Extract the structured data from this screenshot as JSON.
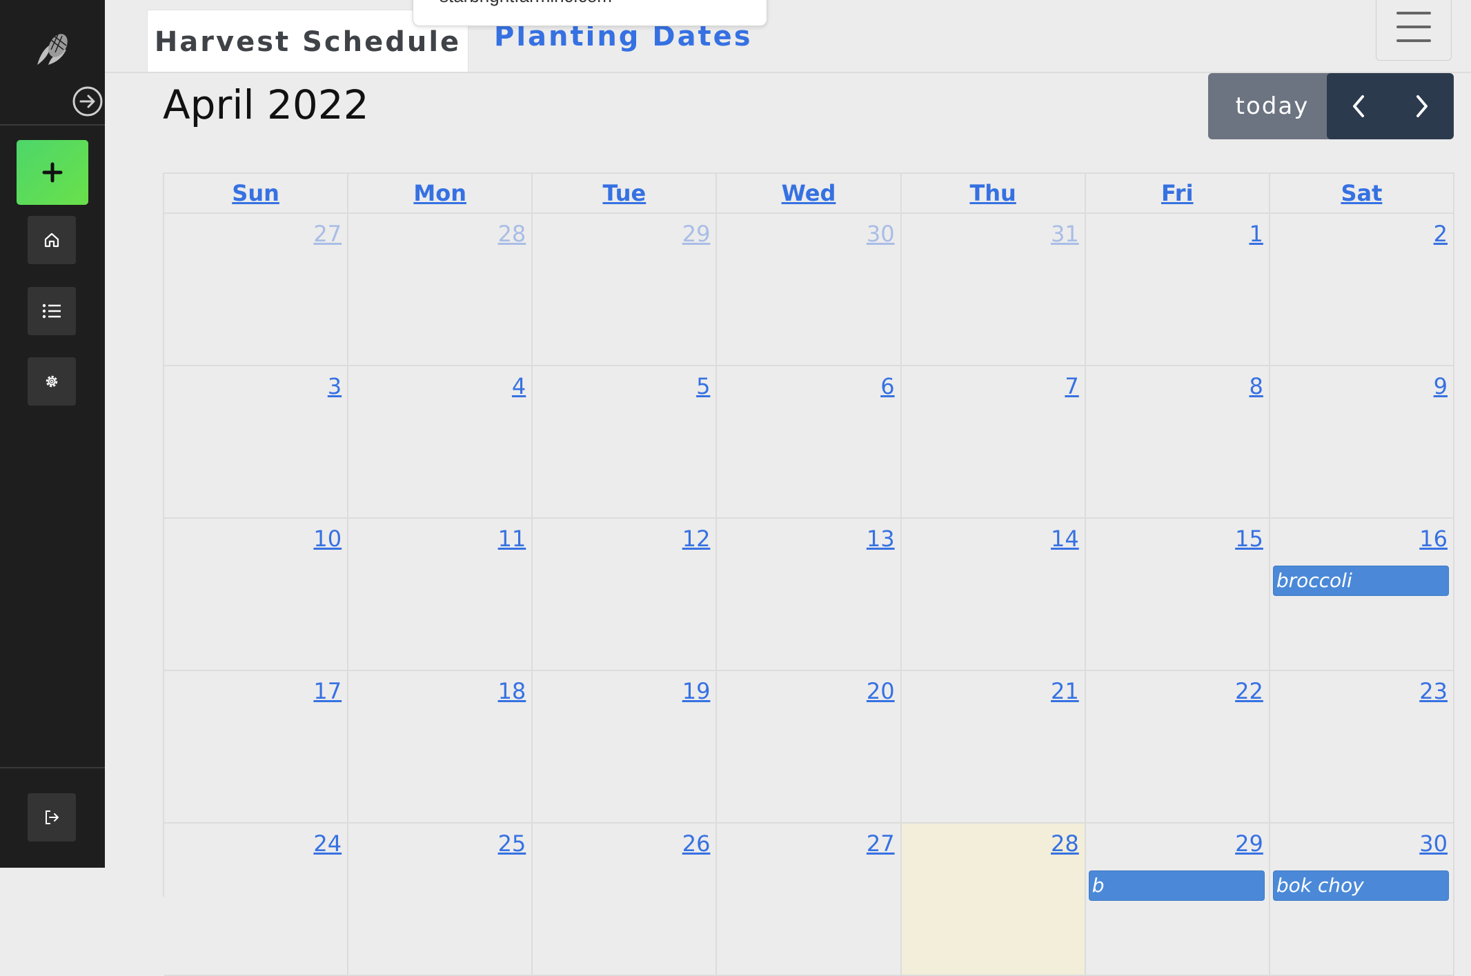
{
  "sidebar": {
    "icons": [
      "corn-logo-icon",
      "arrow-right-circle-icon",
      "plus-icon",
      "home-icon",
      "list-icon",
      "gear-icon",
      "logout-icon"
    ]
  },
  "tabs": [
    {
      "label": "Harvest Schedule",
      "active": true
    },
    {
      "label": "Planting Dates",
      "active": false
    }
  ],
  "url_popup": {
    "text": "starbrightfarminc.com"
  },
  "calendar": {
    "title": "April 2022",
    "today_label": "today",
    "weekdays": [
      "Sun",
      "Mon",
      "Tue",
      "Wed",
      "Thu",
      "Fri",
      "Sat"
    ],
    "weeks": [
      [
        {
          "d": "27",
          "other": true
        },
        {
          "d": "28",
          "other": true
        },
        {
          "d": "29",
          "other": true
        },
        {
          "d": "30",
          "other": true
        },
        {
          "d": "31",
          "other": true
        },
        {
          "d": "1"
        },
        {
          "d": "2"
        }
      ],
      [
        {
          "d": "3"
        },
        {
          "d": "4"
        },
        {
          "d": "5"
        },
        {
          "d": "6"
        },
        {
          "d": "7"
        },
        {
          "d": "8"
        },
        {
          "d": "9"
        }
      ],
      [
        {
          "d": "10"
        },
        {
          "d": "11"
        },
        {
          "d": "12"
        },
        {
          "d": "13"
        },
        {
          "d": "14"
        },
        {
          "d": "15"
        },
        {
          "d": "16",
          "event": "broccoli"
        }
      ],
      [
        {
          "d": "17"
        },
        {
          "d": "18"
        },
        {
          "d": "19"
        },
        {
          "d": "20"
        },
        {
          "d": "21"
        },
        {
          "d": "22"
        },
        {
          "d": "23"
        }
      ],
      [
        {
          "d": "24"
        },
        {
          "d": "25"
        },
        {
          "d": "26"
        },
        {
          "d": "27"
        },
        {
          "d": "28",
          "today": true
        },
        {
          "d": "29",
          "event": "b"
        },
        {
          "d": "30",
          "event": "bok choy"
        }
      ]
    ]
  },
  "colors": {
    "accent": "#3671e2",
    "sidebar": "#1e1e1e",
    "add_button": "#5cdc58",
    "event": "#4b89d8",
    "today_bg": "#f2eed9"
  }
}
